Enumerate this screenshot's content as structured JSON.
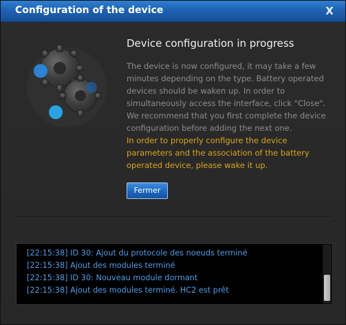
{
  "dialog": {
    "title": "Configuration of the device",
    "close_label": "X"
  },
  "content": {
    "heading": "Device configuration in progress",
    "description": "The device is now configured, it may take a few minutes depending on the type. Battery operated devices should be waken up. In order to simultaneously access the interface, click \"Close\". We recommend that you first complete the device configuration before adding the next one.",
    "warning": "In order to properly configure the device parameters and the association of the battery operated device, please wake it up.",
    "button_label": "Fermer"
  },
  "log": {
    "lines": [
      "[22:15:38] ID 30: Ajout du protocole des noeuds terminé",
      "[22:15:38] Ajout des modules terminé",
      "[22:15:38] ID 30: Nouveau module dormant",
      "[22:15:38] Ajout des modules terminé. HC2 est prêt"
    ]
  },
  "colors": {
    "titlebar": "#1f63b3",
    "warning_text": "#d9a51a",
    "log_text": "#4f9ee8",
    "gear_dot": "#2aa3e6"
  },
  "icons": {
    "close": "close-icon",
    "gears": "gears-icon"
  }
}
